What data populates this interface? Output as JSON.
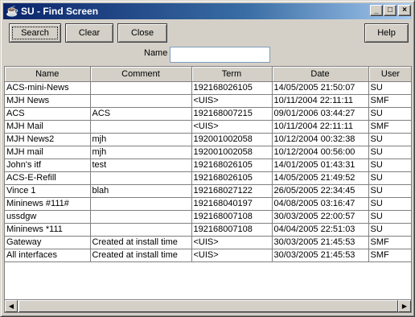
{
  "window": {
    "title": "SU - Find Screen",
    "icon": "java-cup-icon",
    "controls": {
      "minimize": "_",
      "maximize": "□",
      "close": "×"
    }
  },
  "toolbar": {
    "search_label": "Search",
    "clear_label": "Clear",
    "close_label": "Close",
    "help_label": "Help"
  },
  "filter": {
    "name_label": "Name",
    "name_value": ""
  },
  "table": {
    "columns": [
      "Name",
      "Comment",
      "Term",
      "Date",
      "User"
    ],
    "rows": [
      [
        "ACS-mini-News",
        "",
        "192168026105",
        "14/05/2005 21:50:07",
        "SU"
      ],
      [
        "MJH News",
        "",
        "<UIS>",
        "10/11/2004 22:11:11",
        "SMF"
      ],
      [
        "ACS",
        "ACS",
        "192168007215",
        "09/01/2006 03:44:27",
        "SU"
      ],
      [
        "MJH Mail",
        "",
        "<UIS>",
        "10/11/2004 22:11:11",
        "SMF"
      ],
      [
        "MJH News2",
        "mjh",
        "192001002058",
        "10/12/2004 00:32:38",
        "SU"
      ],
      [
        "MJH mail",
        "mjh",
        "192001002058",
        "10/12/2004 00:56:00",
        "SU"
      ],
      [
        "John's itf",
        "test",
        "192168026105",
        "14/01/2005 01:43:31",
        "SU"
      ],
      [
        "ACS-E-Refill",
        "",
        "192168026105",
        "14/05/2005 21:49:52",
        "SU"
      ],
      [
        "Vince 1",
        "blah",
        "192168027122",
        "26/05/2005 22:34:45",
        "SU"
      ],
      [
        "Mininews #111#",
        "",
        "192168040197",
        "04/08/2005 03:16:47",
        "SU"
      ],
      [
        "ussdgw",
        "",
        "192168007108",
        "30/03/2005 22:00:57",
        "SU"
      ],
      [
        "Mininews *111",
        "",
        "192168007108",
        "04/04/2005 22:51:03",
        "SU"
      ],
      [
        "Gateway",
        "Created at install time",
        "<UIS>",
        "30/03/2005 21:45:53",
        "SMF"
      ],
      [
        "All interfaces",
        "Created at install time",
        "<UIS>",
        "30/03/2005 21:45:53",
        "SMF"
      ]
    ]
  },
  "scrollbar": {
    "left_arrow": "◀",
    "right_arrow": "▶"
  }
}
